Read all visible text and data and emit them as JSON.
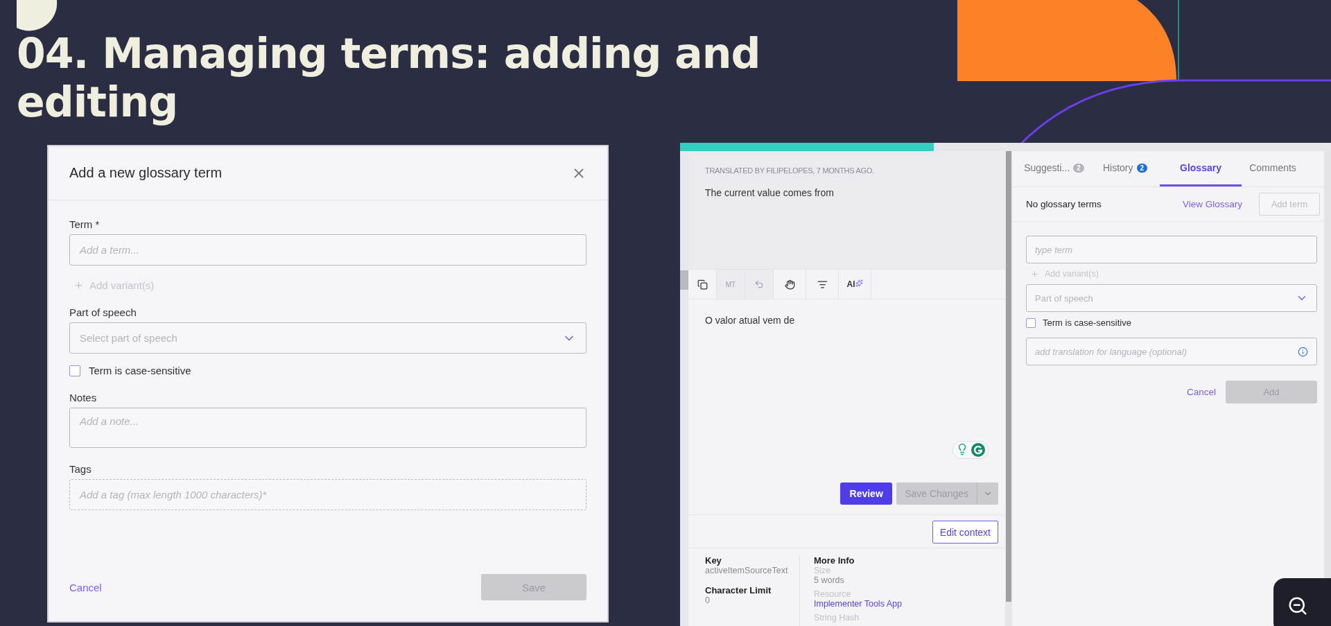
{
  "slide": {
    "title": "04. Managing terms: adding and editing"
  },
  "dialog": {
    "title": "Add a new glossary term",
    "fields": [
      {
        "kind": "input",
        "label": "Term *",
        "placeholder": "Add a term..."
      },
      {
        "kind": "add",
        "label": "Add variant(s)",
        "disabled": true
      },
      {
        "kind": "select",
        "label": "Part of speech",
        "placeholder": "Select part of speech"
      },
      {
        "kind": "checkbox",
        "label": "Term is case-sensitive",
        "checked": false
      },
      {
        "kind": "textarea",
        "label": "Notes",
        "placeholder": "Add a note..."
      },
      {
        "kind": "tags",
        "label": "Tags",
        "placeholder": "Add a tag (max length 1000 characters)*"
      }
    ],
    "cancel": "Cancel",
    "save": {
      "label": "Save",
      "disabled": true
    }
  },
  "editor": {
    "progress": {
      "level": 0.39
    },
    "source": {
      "meta": "TRANSLATED BY FILIPELOPES, 7 MONTHS AGO.",
      "text": "The current value comes from"
    },
    "tools": [
      {
        "kind": "copy",
        "disabled": false
      },
      {
        "kind": "text",
        "label": "MT",
        "disabled": true
      },
      {
        "kind": "undo",
        "disabled": true
      },
      {
        "kind": "hand",
        "disabled": false
      },
      {
        "kind": "search",
        "disabled": false
      },
      {
        "kind": "ai",
        "label": "AI",
        "disabled": false
      }
    ],
    "translation": "O valor atual vem de",
    "review": "Review",
    "save": {
      "label": "Save Changes",
      "disabled": true
    },
    "edit_context": "Edit context",
    "info": {
      "left": [
        {
          "label": "Key",
          "value": "activeItemSourceText"
        },
        {
          "label": "Character Limit",
          "value": "0"
        }
      ],
      "heading": "More Info",
      "right": [
        {
          "label": "Size",
          "value": "5 words",
          "kind": "text"
        },
        {
          "label": "Resource",
          "value": "Implementer Tools App",
          "kind": "link"
        },
        {
          "label": "String Hash"
        }
      ]
    }
  },
  "side_panel": {
    "tabs": [
      {
        "label": "Suggesti...",
        "badge": "2",
        "badge_active": false,
        "selected": false
      },
      {
        "label": "History",
        "badge": "2",
        "badge_active": true,
        "selected": false
      },
      {
        "label": "Glossary",
        "selected": true
      },
      {
        "label": "Comments",
        "selected": false
      }
    ],
    "status": "No glossary terms",
    "view_link": "View Glossary",
    "add_term": {
      "label": "Add term",
      "disabled": true
    },
    "form": {
      "term_placeholder": "type term",
      "add_variant": {
        "label": "Add variant(s)",
        "disabled": true
      },
      "part_of_speech": "Part of speech",
      "case_sensitive": {
        "label": "Term is case-sensitive",
        "checked": false
      },
      "translation_placeholder": "add translation for language (optional)",
      "cancel": "Cancel",
      "add": {
        "label": "Add",
        "disabled": true
      }
    }
  }
}
